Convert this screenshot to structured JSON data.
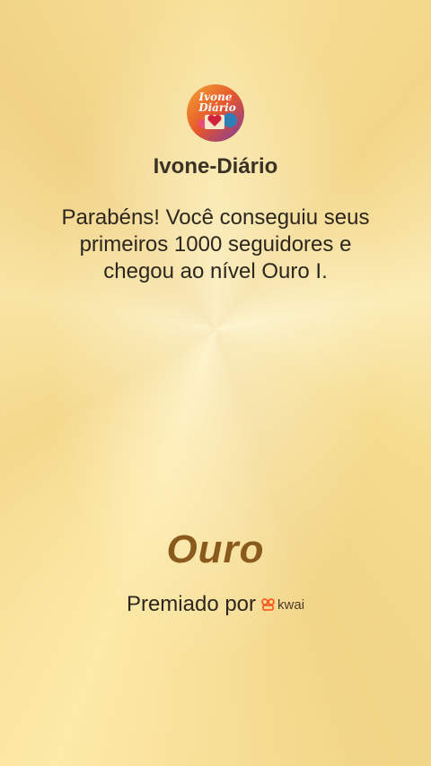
{
  "profile": {
    "username": "Ivone-Diário",
    "avatar_text": [
      "Ivone",
      "Diário"
    ]
  },
  "message": "Parabéns! Você conseguiu seus primeiros 1000 seguidores e chegou ao nível Ouro I.",
  "level": "Ouro",
  "awarded_by": {
    "label": "Premiado por",
    "brand": "kwai",
    "brand_icon": "kwai-logo-icon"
  },
  "colors": {
    "background": "#f5dc8f",
    "level_text": "#8a5a1c",
    "brand_orange": "#ff5b20"
  }
}
